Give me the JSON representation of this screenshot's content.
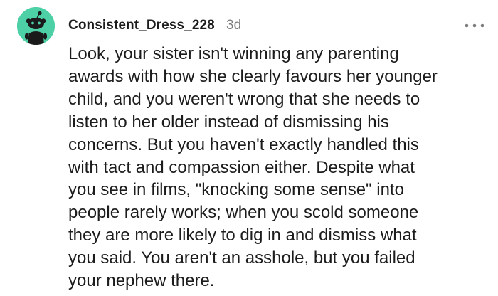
{
  "comment": {
    "author": "Consistent_Dress_228",
    "age": "3d",
    "avatar_icon": "reddit-snoo-avatar-icon",
    "avatar_color": "#4dd0a6",
    "more_icon": "more-options-icon",
    "body_lines": [
      "Look, your sister isn't winning any parenting",
      "awards with how she clearly favours her younger",
      "child, and you weren't wrong that she needs to",
      "listen to her older instead of dismissing his",
      "concerns. But you haven't exactly handled this",
      "with tact and compassion either. Despite what",
      "you see in films, \"knocking some sense\" into",
      "people rarely works; when you scold someone",
      "they are more likely to dig in and dismiss what",
      "you said. You aren't an asshole, but you failed",
      "your nephew there."
    ]
  }
}
